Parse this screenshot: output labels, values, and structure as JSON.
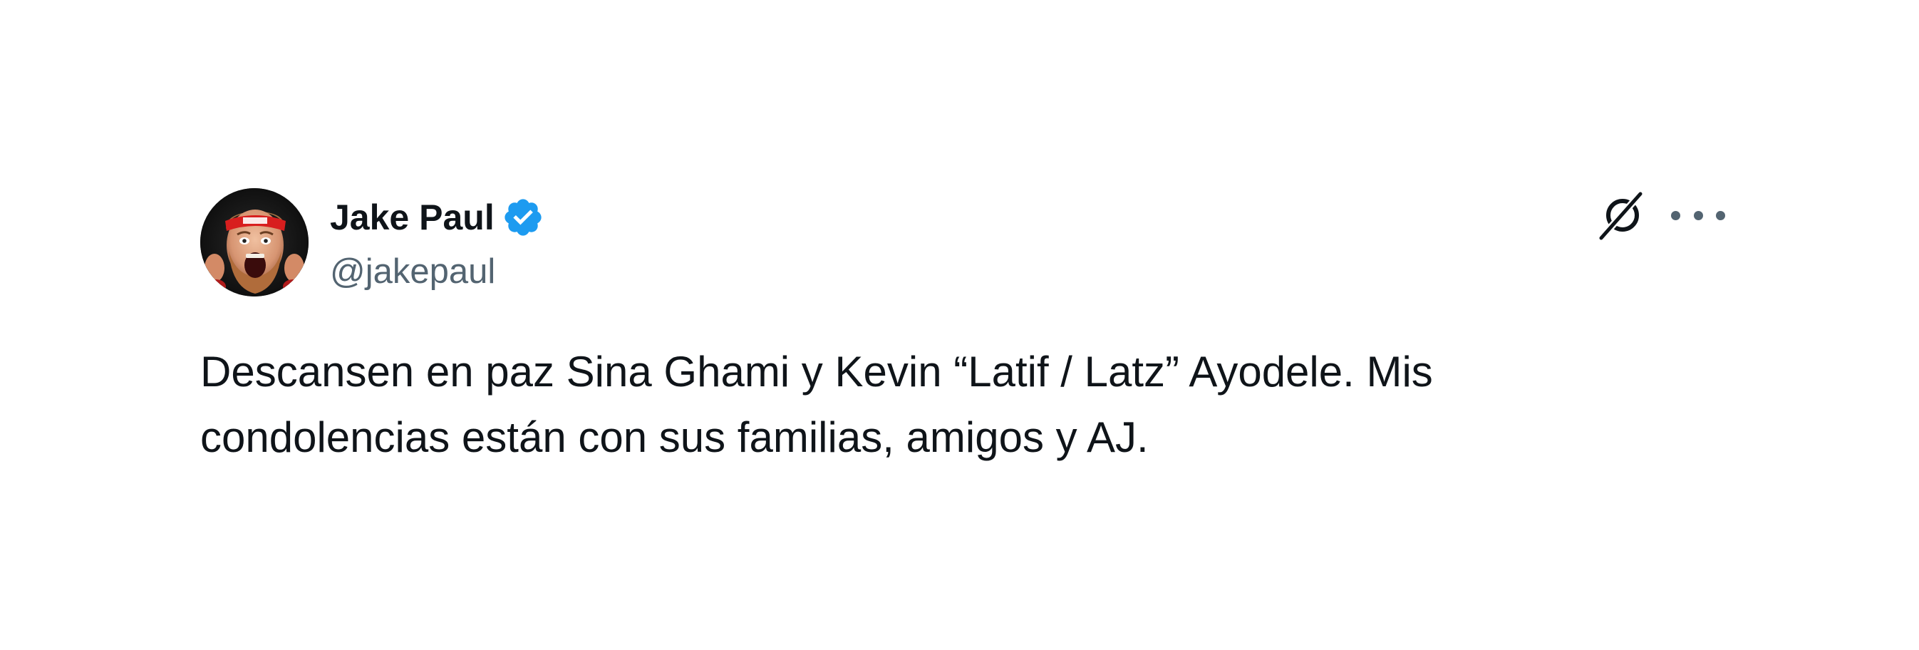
{
  "author": {
    "name": "Jake Paul",
    "handle": "@jakepaul",
    "verified": true,
    "avatar": "avatar-image"
  },
  "tweet": {
    "text_lines": [
      "Descansen en paz Sina Ghami y Kevin “Latif / Latz” Ayodele. Mis",
      "condolencias están con sus familias, amigos y AJ."
    ]
  },
  "icons": {
    "verified": "verified-check-icon",
    "platform": "x-logo-icon",
    "more": "more-options-icon"
  },
  "colors": {
    "background": "#ffffff",
    "text": "#0f1419",
    "secondary_text": "#536471",
    "verified_blue": "#1d9bf0"
  }
}
